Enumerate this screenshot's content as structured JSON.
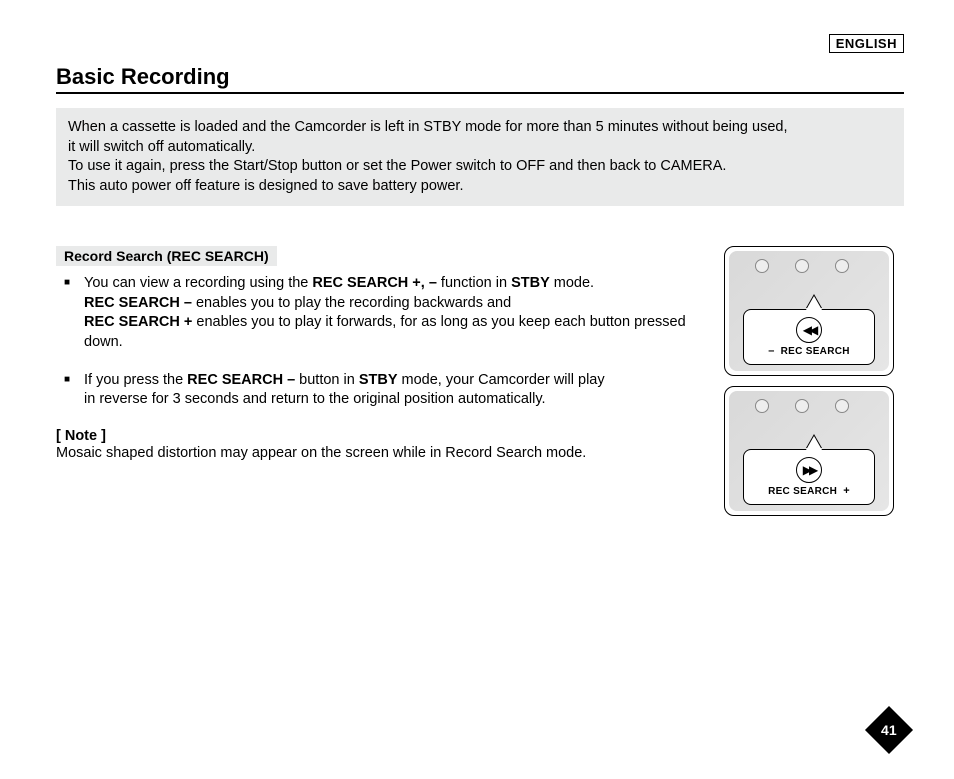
{
  "language_badge": "ENGLISH",
  "title": "Basic Recording",
  "infobox": {
    "line1": "When a cassette is loaded and the Camcorder is left in STBY mode for more than 5 minutes without being used,",
    "line2": "it will switch off automatically.",
    "line3": "To use it again, press the Start/Stop button or set the Power switch to OFF and then back to CAMERA.",
    "line4": "This auto power off feature is designed to save battery power."
  },
  "subheading": "Record Search (REC SEARCH)",
  "bullet1": {
    "pre": "You can view a recording using the ",
    "bold1": "REC SEARCH +, –",
    "mid1": " function in ",
    "bold2": "STBY",
    "mid2": " mode.",
    "line2_bold": "REC SEARCH –",
    "line2_rest": " enables you to play the recording backwards and",
    "line3_bold": "REC SEARCH +",
    "line3_rest": " enables you to play it forwards, for as long as you keep each button pressed down."
  },
  "bullet2": {
    "pre": "If you press the ",
    "bold1": "REC SEARCH –",
    "mid1": " button in ",
    "bold2": "STBY",
    "mid2": " mode, your Camcorder will play",
    "line2": "in reverse for 3 seconds and return to the original position automatically."
  },
  "note": {
    "label": "[ Note ]",
    "text": "Mosaic shaped distortion may appear on the screen while in Record Search mode."
  },
  "figures": {
    "fig1": {
      "symbol": "–",
      "icon": "◀◀",
      "label": "REC SEARCH"
    },
    "fig2": {
      "symbol": "+",
      "icon": "▶▶",
      "label": "REC SEARCH"
    }
  },
  "page_number": "41"
}
